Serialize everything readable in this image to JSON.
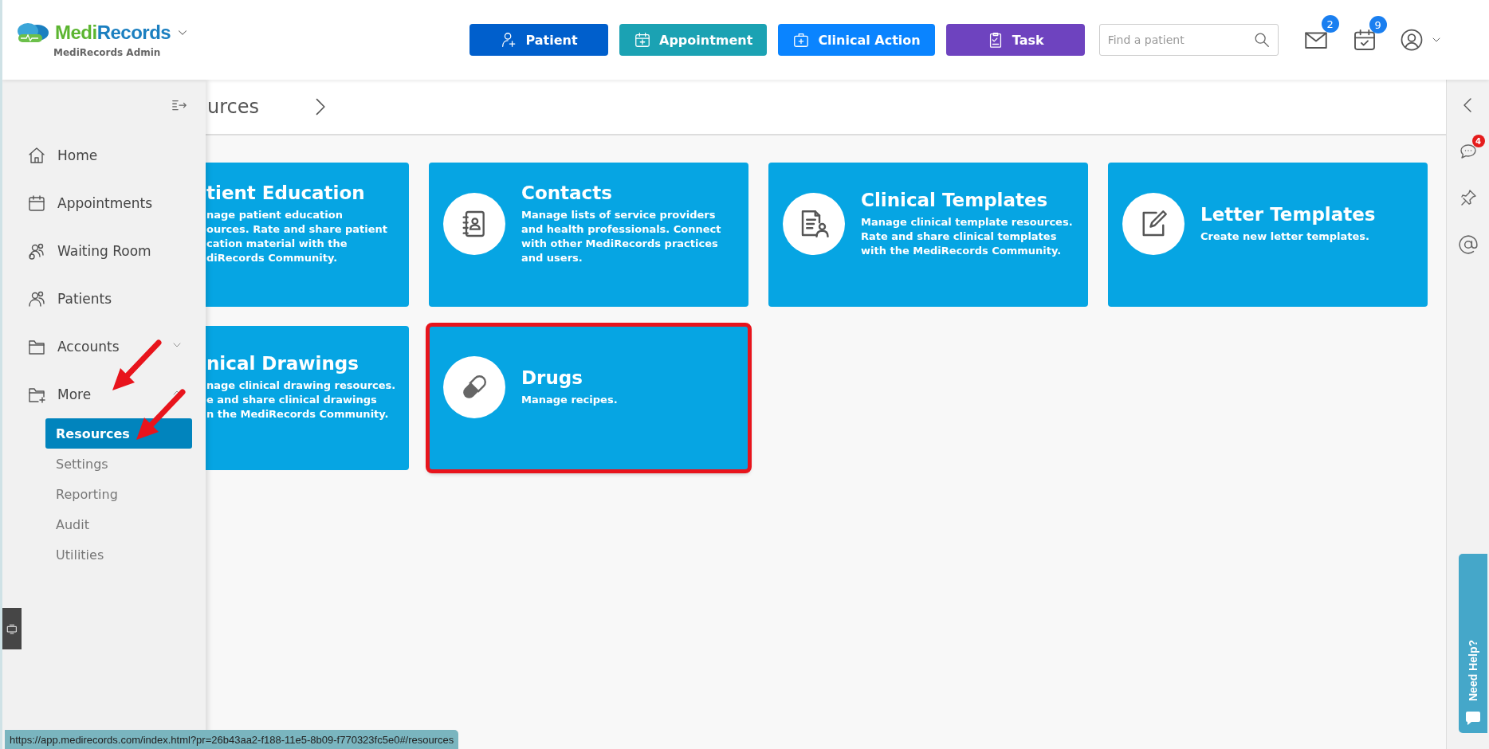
{
  "header": {
    "brand_first": "Medi",
    "brand_second": "Records",
    "subtitle": "MediRecords Admin",
    "actions": [
      {
        "label": "Patient",
        "color": "#005fcc"
      },
      {
        "label": "Appointment",
        "color": "#1ba2b3"
      },
      {
        "label": "Clinical Action",
        "color": "#0a84ff"
      },
      {
        "label": "Task",
        "color": "#6e43bf"
      }
    ],
    "search": {
      "placeholder": "Find a patient"
    },
    "messages_badge": "2",
    "tasks_badge": "9"
  },
  "sidebar": {
    "items": [
      {
        "label": "Home",
        "kind": "link"
      },
      {
        "label": "Appointments",
        "kind": "link"
      },
      {
        "label": "Waiting Room",
        "kind": "link"
      },
      {
        "label": "Patients",
        "kind": "link"
      },
      {
        "label": "Accounts",
        "kind": "group",
        "expanded": false
      },
      {
        "label": "More",
        "kind": "group",
        "expanded": true,
        "children": [
          {
            "label": "Resources",
            "selected": true
          },
          {
            "label": "Settings",
            "selected": false
          },
          {
            "label": "Reporting",
            "selected": false
          },
          {
            "label": "Audit",
            "selected": false
          },
          {
            "label": "Utilities",
            "selected": false
          }
        ]
      }
    ]
  },
  "page": {
    "title": "urces",
    "cards": [
      {
        "kind": "clipped",
        "title": "tient Education",
        "lines": [
          "nage patient education",
          "ources. Rate and share patient",
          "cation material with the",
          "diRecords Community."
        ],
        "highlighted": false
      },
      {
        "kind": "full",
        "title": "Contacts",
        "lines": [
          "Manage lists of service providers",
          "and health professionals. Connect",
          "with other MediRecords practices",
          "and users."
        ],
        "highlighted": false
      },
      {
        "kind": "full",
        "title": "Clinical Templates",
        "lines": [
          "Manage clinical template resources.",
          "Rate and share clinical templates",
          "with the MediRecords Community."
        ],
        "highlighted": false
      },
      {
        "kind": "full",
        "title": "Letter Templates",
        "lines": [
          "Create new letter templates."
        ],
        "highlighted": false
      },
      {
        "kind": "clipped",
        "title": "nical Drawings",
        "lines": [
          "nage clinical drawing resources.",
          "e and share clinical drawings",
          "n the MediRecords Community."
        ],
        "highlighted": false
      },
      {
        "kind": "full",
        "title": "Drugs",
        "lines": [
          "Manage recipes."
        ],
        "highlighted": true
      }
    ]
  },
  "right_rail": {
    "chat_badge": "4",
    "help_label": "Need Help?"
  },
  "status_url": "https://app.medirecords.com/index.html?pr=26b43aa2-f188-11e5-8b09-f770323fc5e0#/resources"
}
